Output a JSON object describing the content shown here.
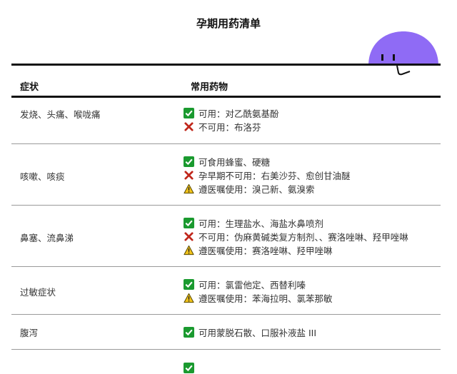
{
  "title": "孕期用药清单",
  "header": {
    "symptom": "症状",
    "medicine": "常用药物"
  },
  "rows": [
    {
      "symptom": "发烧、头痛、喉咙痛",
      "lines": [
        {
          "icon": "check-icon",
          "text": "可用：对乙酰氨基酚"
        },
        {
          "icon": "cross-icon",
          "text": "不可用：布洛芬"
        }
      ]
    },
    {
      "symptom": "咳嗽、咳痰",
      "lines": [
        {
          "icon": "check-icon",
          "text": "可食用蜂蜜、硬糖"
        },
        {
          "icon": "cross-icon",
          "text": "孕早期不可用：右美沙芬、愈创甘油醚"
        },
        {
          "icon": "warning-icon",
          "text": "遵医嘱使用：溴己新、氨溴索"
        }
      ]
    },
    {
      "symptom": "鼻塞、流鼻涕",
      "lines": [
        {
          "icon": "check-icon",
          "text": "可用：生理盐水、海盐水鼻喷剂"
        },
        {
          "icon": "cross-icon",
          "text": "不可用：伪麻黄碱类复方制剂、、赛洛唑啉、羟甲唑啉"
        },
        {
          "icon": "warning-icon",
          "text": "遵医嘱使用：赛洛唑啉、羟甲唑啉"
        }
      ]
    },
    {
      "symptom": "过敏症状",
      "lines": [
        {
          "icon": "check-icon",
          "text": "可用：氯雷他定、西替利嗪"
        },
        {
          "icon": "warning-icon",
          "text": "遵医嘱使用：苯海拉明、氯苯那敏"
        }
      ]
    },
    {
      "symptom": "腹泻",
      "lines": [
        {
          "icon": "check-icon",
          "text": "可用蒙脱石散、口服补液盐 III"
        }
      ]
    },
    {
      "symptom": "",
      "lines": [
        {
          "icon": "check-icon",
          "text": ""
        }
      ]
    }
  ],
  "colors": {
    "check": "#1a9a2f",
    "cross": "#c0271c",
    "warning": "#f3c41b",
    "mascot": "#8f6bf5"
  }
}
